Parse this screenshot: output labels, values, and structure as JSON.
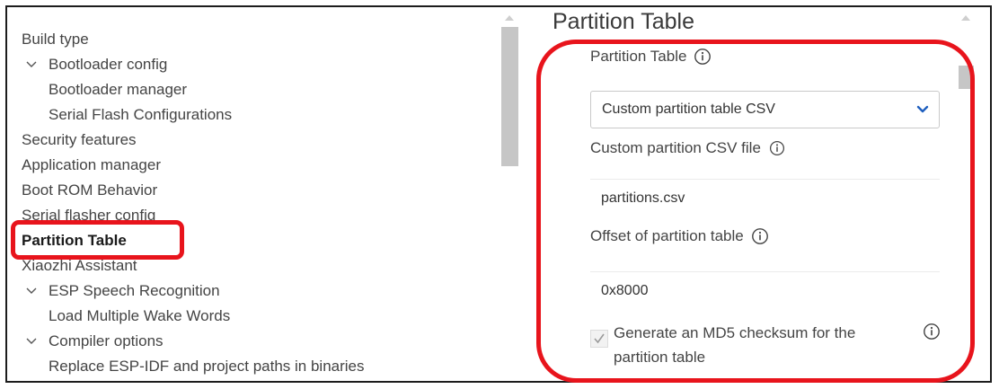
{
  "tree": {
    "items": [
      {
        "label": "Build type",
        "level": 0,
        "expandable": false,
        "active": false
      },
      {
        "label": "Bootloader config",
        "level": 0,
        "expandable": true,
        "active": false
      },
      {
        "label": "Bootloader manager",
        "level": 1,
        "expandable": false,
        "active": false
      },
      {
        "label": "Serial Flash Configurations",
        "level": 1,
        "expandable": false,
        "active": false
      },
      {
        "label": "Security features",
        "level": 0,
        "expandable": false,
        "active": false
      },
      {
        "label": "Application manager",
        "level": 0,
        "expandable": false,
        "active": false
      },
      {
        "label": "Boot ROM Behavior",
        "level": 0,
        "expandable": false,
        "active": false
      },
      {
        "label": "Serial flasher config",
        "level": 0,
        "expandable": false,
        "active": false
      },
      {
        "label": "Partition Table",
        "level": 0,
        "expandable": false,
        "active": true
      },
      {
        "label": "Xiaozhi Assistant",
        "level": 0,
        "expandable": false,
        "active": false
      },
      {
        "label": "ESP Speech Recognition",
        "level": 0,
        "expandable": true,
        "active": false
      },
      {
        "label": "Load Multiple Wake Words",
        "level": 1,
        "expandable": false,
        "active": false
      },
      {
        "label": "Compiler options",
        "level": 0,
        "expandable": true,
        "active": false
      },
      {
        "label": "Replace ESP-IDF and project paths in binaries",
        "level": 1,
        "expandable": false,
        "active": false
      }
    ]
  },
  "panel": {
    "title": "Partition Table",
    "partition_table_label": "Partition Table",
    "partition_table_value": "Custom partition table CSV",
    "csv_file_label": "Custom partition CSV file",
    "csv_file_value": "partitions.csv",
    "offset_label": "Offset of partition table",
    "offset_value": "0x8000",
    "md5_label": "Generate an MD5 checksum for the partition table",
    "md5_checked": true
  },
  "colors": {
    "highlight": "#e8141c",
    "caret": "#1f5fbf"
  },
  "icons": {
    "info": "info-icon",
    "chevron": "chevron-down-icon",
    "check": "check-icon"
  }
}
